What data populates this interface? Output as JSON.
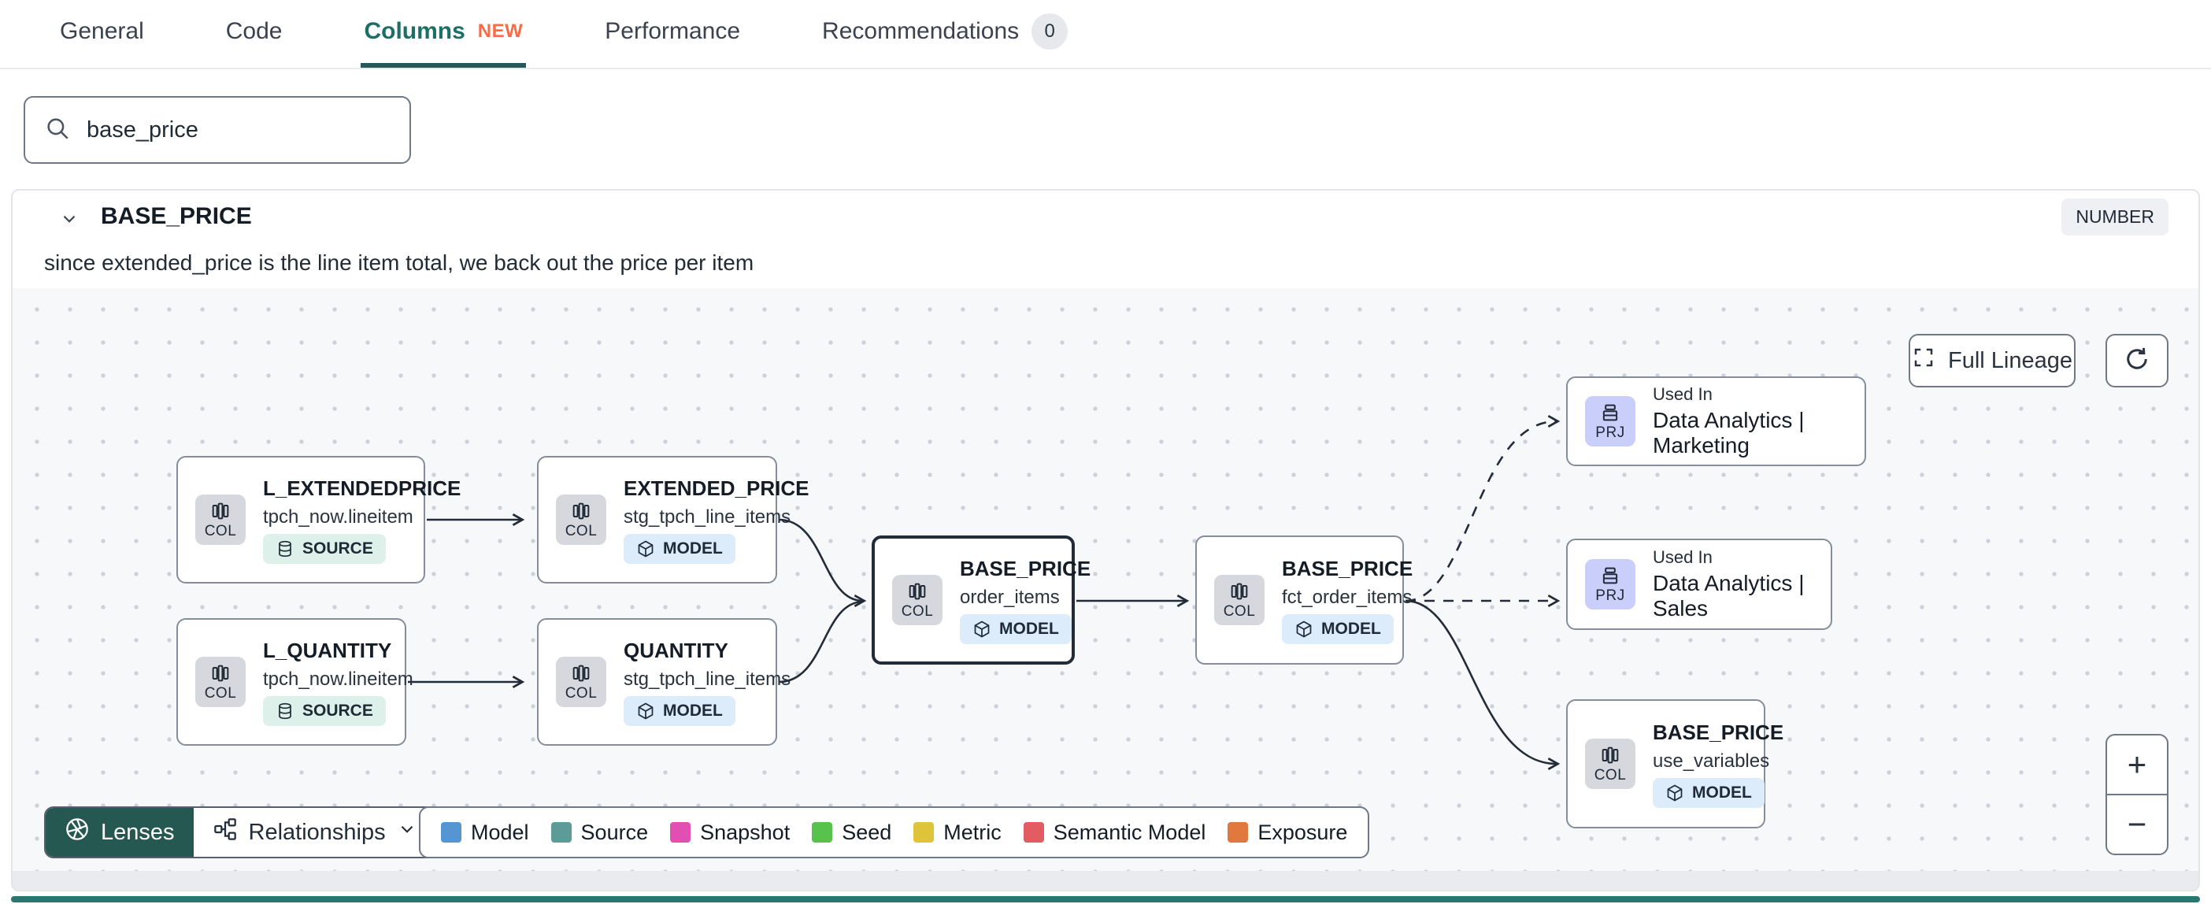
{
  "tabs": [
    {
      "label": "General"
    },
    {
      "label": "Code"
    },
    {
      "label": "Columns",
      "badge": "NEW",
      "active": true
    },
    {
      "label": "Performance"
    },
    {
      "label": "Recommendations",
      "count": "0"
    }
  ],
  "search": {
    "value": "base_price"
  },
  "column_panel": {
    "name": "BASE_PRICE",
    "data_type": "NUMBER",
    "description": "since extended_price is the line item total, we back out the price per item"
  },
  "lineage": {
    "controls": {
      "full_lineage_label": "Full Lineage",
      "zoom_in": "+",
      "zoom_out": "−",
      "lenses_label": "Lenses",
      "relationships_label": "Relationships"
    },
    "nodes": [
      {
        "badge": "COL",
        "title": "L_EXTENDEDPRICE",
        "subtitle": "tpch_now.lineitem",
        "kind": "SOURCE"
      },
      {
        "badge": "COL",
        "title": "EXTENDED_PRICE",
        "subtitle": "stg_tpch_line_items",
        "kind": "MODEL"
      },
      {
        "badge": "COL",
        "title": "L_QUANTITY",
        "subtitle": "tpch_now.lineitem",
        "kind": "SOURCE"
      },
      {
        "badge": "COL",
        "title": "QUANTITY",
        "subtitle": "stg_tpch_line_items",
        "kind": "MODEL"
      },
      {
        "badge": "COL",
        "title": "BASE_PRICE",
        "subtitle": "order_items",
        "kind": "MODEL",
        "selected": true
      },
      {
        "badge": "COL",
        "title": "BASE_PRICE",
        "subtitle": "fct_order_items",
        "kind": "MODEL"
      },
      {
        "badge": "PRJ",
        "used_in": "Used In",
        "title": "Data Analytics | Marketing"
      },
      {
        "badge": "PRJ",
        "used_in": "Used In",
        "title": "Data Analytics | Sales"
      },
      {
        "badge": "COL",
        "title": "BASE_PRICE",
        "subtitle": "use_variables",
        "kind": "MODEL"
      }
    ],
    "legend": [
      {
        "label": "Model",
        "color": "#5596d2"
      },
      {
        "label": "Source",
        "color": "#5d9b98"
      },
      {
        "label": "Snapshot",
        "color": "#e24fb2"
      },
      {
        "label": "Seed",
        "color": "#57c24e"
      },
      {
        "label": "Metric",
        "color": "#dfc43a"
      },
      {
        "label": "Semantic Model",
        "color": "#e25c62"
      },
      {
        "label": "Exposure",
        "color": "#e1793f"
      }
    ],
    "colors": {
      "accent_teal": "#1d6f66",
      "new_badge_orange": "#f96b46",
      "edge": "#222c38",
      "canvas_bg": "#f7f8fa"
    }
  }
}
